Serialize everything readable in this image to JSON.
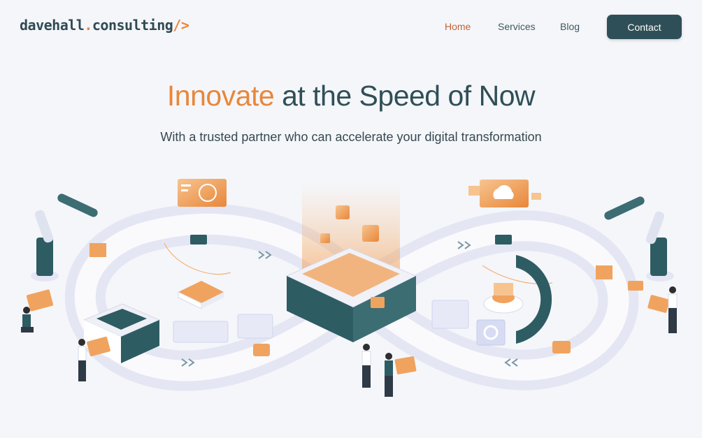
{
  "logo": {
    "name": "davehall",
    "dot": ".",
    "domain": "consulting",
    "suffix": "/>"
  },
  "nav": {
    "items": [
      {
        "label": "Home",
        "active": true
      },
      {
        "label": "Services",
        "active": false
      },
      {
        "label": "Blog",
        "active": false
      }
    ],
    "contact_label": "Contact"
  },
  "hero": {
    "title_accent": "Innovate",
    "title_rest": " at the Speed of Now",
    "subtitle": "With a trusted partner who can accelerate your digital transformation"
  },
  "colors": {
    "accent": "#e8873a",
    "primary_dark": "#2e4f57",
    "background": "#f5f6fa"
  },
  "illustration": {
    "icons": [
      "code-icon",
      "cloud-upload-icon",
      "chevron-right-icon",
      "chevron-left-icon"
    ],
    "code_badge": "</>"
  }
}
